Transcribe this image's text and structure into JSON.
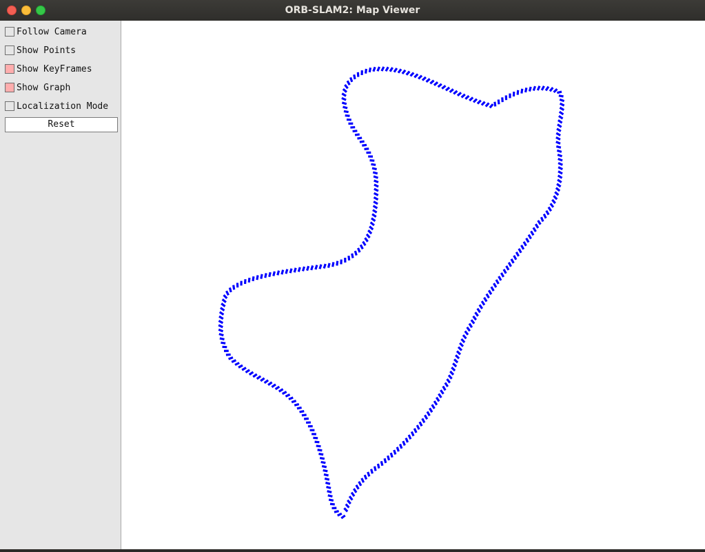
{
  "window": {
    "title": "ORB-SLAM2: Map Viewer"
  },
  "panel": {
    "options": [
      {
        "label": "Follow Camera",
        "checked": false
      },
      {
        "label": "Show Points",
        "checked": false
      },
      {
        "label": "Show KeyFrames",
        "checked": true
      },
      {
        "label": "Show Graph",
        "checked": true
      },
      {
        "label": "Localization Mode",
        "checked": false
      }
    ],
    "reset_label": "Reset"
  },
  "colors": {
    "keyframe": "#0000ff",
    "checked": "#ffadad",
    "panel_bg": "#e6e6e6"
  }
}
